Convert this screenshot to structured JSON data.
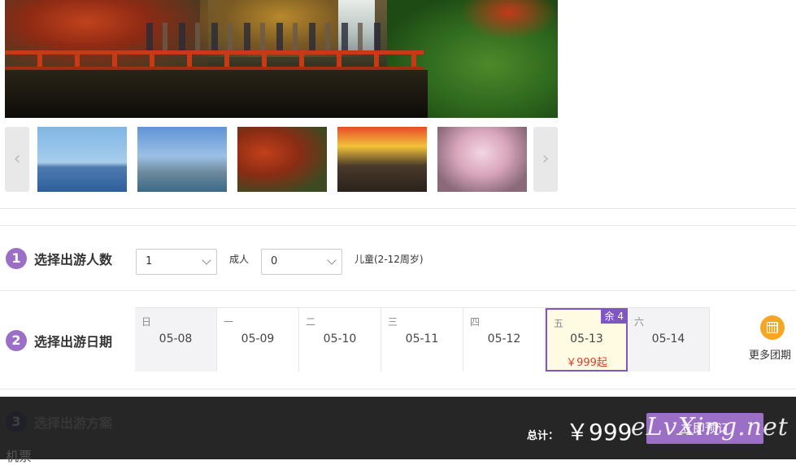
{
  "gallery": {
    "prev_icon": "chevron-left-icon",
    "next_icon": "chevron-right-icon",
    "prev_glyph": "‹",
    "next_glyph": "›"
  },
  "travelers": {
    "step_num": "1",
    "title": "选择出游人数",
    "adult_value": "1",
    "adult_label": "成人",
    "child_value": "0",
    "child_label": "儿童(2-12周岁)"
  },
  "dates": {
    "step_num": "2",
    "title": "选择出游日期",
    "days": [
      {
        "weekday": "日",
        "date": "05-08"
      },
      {
        "weekday": "一",
        "date": "05-09"
      },
      {
        "weekday": "二",
        "date": "05-10"
      },
      {
        "weekday": "三",
        "date": "05-11"
      },
      {
        "weekday": "四",
        "date": "05-12"
      },
      {
        "weekday": "五",
        "date": "05-13",
        "badge": "余 4",
        "price": "￥999起"
      },
      {
        "weekday": "六",
        "date": "05-14"
      }
    ],
    "more_label": "更多团期",
    "more_icon": "calendar-icon"
  },
  "plan": {
    "step_num": "3",
    "title": "选择出游方案",
    "sub_label": "机票"
  },
  "footer": {
    "total_label": "总计：",
    "total_value": "￥999",
    "book_label": "立即预订",
    "watermark": "eLvXing.net"
  },
  "colors": {
    "accent": "#9b6fc6",
    "selected_border": "#7e57c2",
    "price": "#e03a2e",
    "calendar_icon": "#f6a623"
  }
}
